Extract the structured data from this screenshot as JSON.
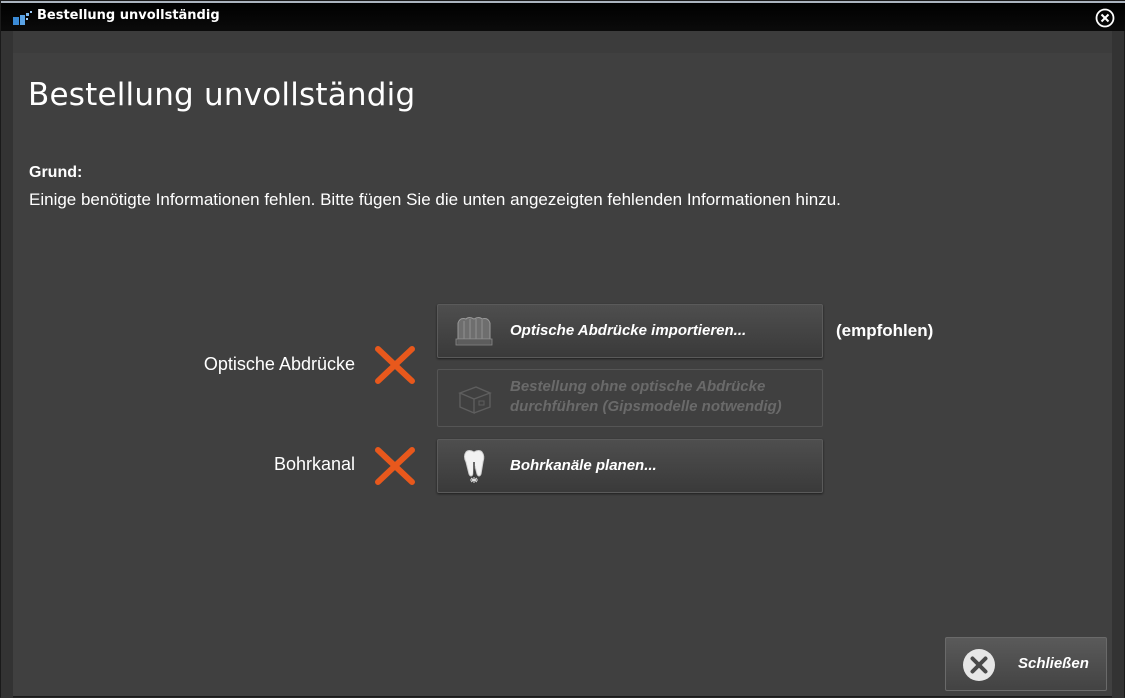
{
  "window": {
    "title": "Bestellung unvollständig",
    "close_icon": "close-circle-icon"
  },
  "main": {
    "heading": "Bestellung unvollständig",
    "reason_label": "Grund:",
    "reason_text": "Einige benötigte Informationen fehlen. Bitte fügen Sie die unten angezeigten fehlenden Informationen hinzu."
  },
  "rows": [
    {
      "label": "Optische Abdrücke",
      "status_icon": "x-mark-icon",
      "status_color": "#e8581c",
      "actions": [
        {
          "label": "Optische Abdrücke importieren...",
          "icon": "dental-scan-icon",
          "enabled": true,
          "note": "(empfohlen)"
        },
        {
          "label_line1": "Bestellung ohne optische Abdrücke",
          "label_line2": "durchführen (Gipsmodelle notwendig)",
          "icon": "box-icon",
          "enabled": false
        }
      ]
    },
    {
      "label": "Bohrkanal",
      "status_icon": "x-mark-icon",
      "status_color": "#e8581c",
      "actions": [
        {
          "label": "Bohrkanäle planen...",
          "icon": "tooth-implant-icon",
          "enabled": true
        }
      ]
    }
  ],
  "footer": {
    "close_label": "Schließen",
    "close_icon": "close-circle-icon"
  },
  "colors": {
    "background": "#404040",
    "titlebar": "#000000",
    "error": "#e8581c",
    "text": "#ffffff",
    "disabled_text": "#6a6a6a"
  }
}
